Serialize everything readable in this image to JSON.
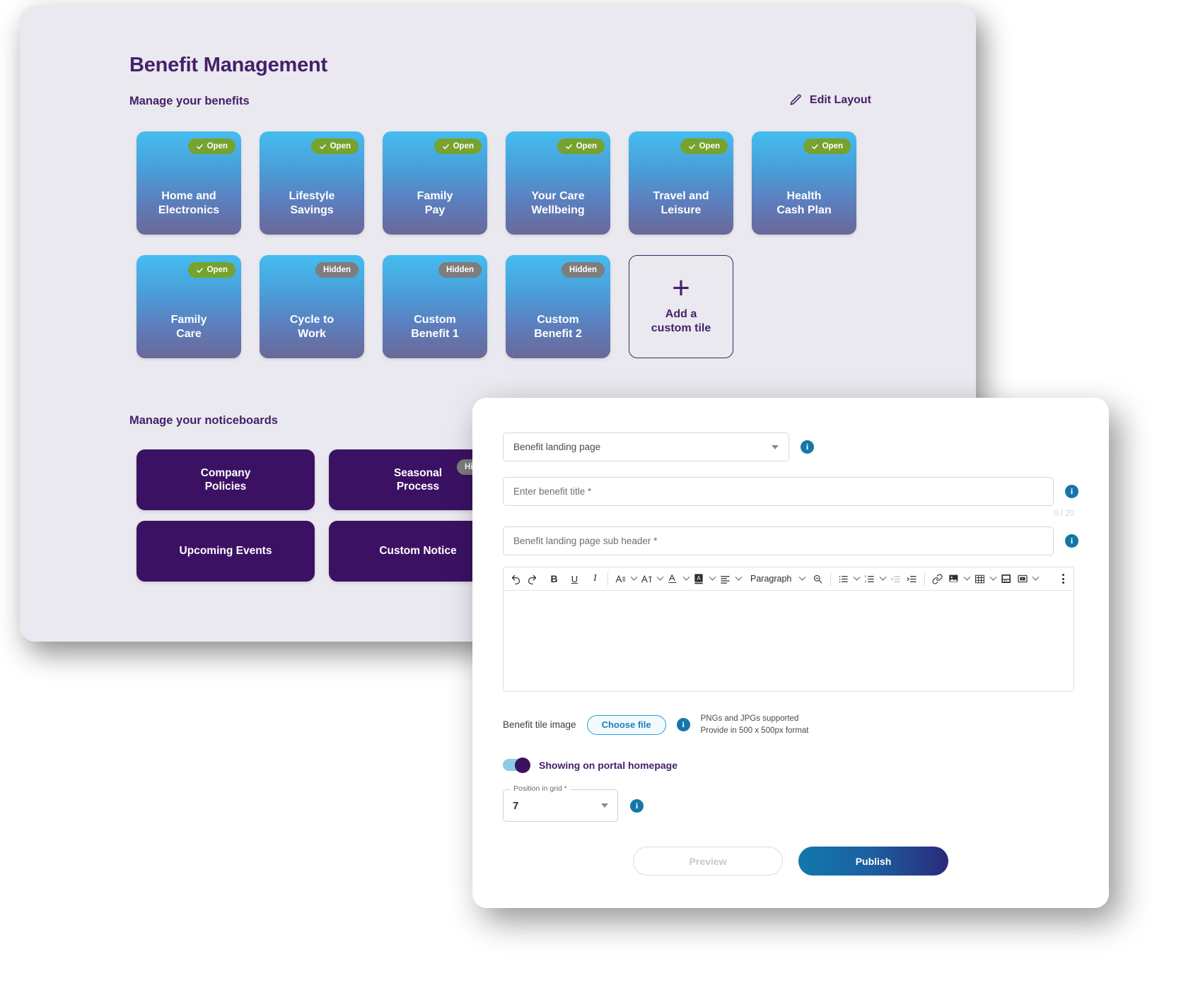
{
  "page": {
    "title": "Benefit Management",
    "benefits_label": "Manage your benefits",
    "noticeboards_label": "Manage your noticeboards",
    "edit_layout_label": "Edit Layout",
    "edit_layout_icon": "pencil-icon"
  },
  "colors": {
    "brand_purple": "#45206c",
    "tile_top": "#44bdf0",
    "tile_bottom": "#6a6898",
    "notice_bg": "#3b1263",
    "badge_open": "#76a22d",
    "badge_hidden": "#7d7d7d",
    "info_blue": "#1477a8",
    "publish_from": "#1179ab",
    "publish_to": "#2b2a7a"
  },
  "tiles": [
    {
      "title": "Home and\nElectronics",
      "status": "Open",
      "status_type": "open"
    },
    {
      "title": "Lifestyle\nSavings",
      "status": "Open",
      "status_type": "open"
    },
    {
      "title": "Family\nPay",
      "status": "Open",
      "status_type": "open"
    },
    {
      "title": "Your Care\nWellbeing",
      "status": "Open",
      "status_type": "open"
    },
    {
      "title": "Travel and\nLeisure",
      "status": "Open",
      "status_type": "open"
    },
    {
      "title": "Health\nCash Plan",
      "status": "Open",
      "status_type": "open"
    },
    {
      "title": "Family\nCare",
      "status": "Open",
      "status_type": "open"
    },
    {
      "title": "Cycle to\nWork",
      "status": "Hidden",
      "status_type": "hidden"
    },
    {
      "title": "Custom\nBenefit 1",
      "status": "Hidden",
      "status_type": "hidden"
    },
    {
      "title": "Custom\nBenefit 2",
      "status": "Hidden",
      "status_type": "hidden"
    }
  ],
  "add_tile": {
    "label": "Add a\ncustom tile",
    "icon": "plus-icon"
  },
  "noticeboards": [
    {
      "title": "Company\nPolicies",
      "status": null,
      "status_type": null
    },
    {
      "title": "Seasonal\nProcess",
      "status": "Hidden",
      "status_type": "hidden"
    },
    {
      "title": "Upcoming Events",
      "status": null,
      "status_type": null
    },
    {
      "title": "Custom Notice",
      "status": null,
      "status_type": null
    }
  ],
  "form": {
    "page_type": {
      "value": "Benefit landing page",
      "icon": "chevron-down-icon",
      "info_icon": "info-icon"
    },
    "title_field": {
      "placeholder": "Enter benefit title *",
      "value": "",
      "counter": "0 / 20",
      "info_icon": "info-icon"
    },
    "subheader_field": {
      "placeholder": "Benefit landing page sub header *",
      "value": "",
      "info_icon": "info-icon"
    },
    "editor": {
      "body": "",
      "toolbar": {
        "undo": "undo-icon",
        "redo": "redo-icon",
        "bold": "B",
        "underline": "U",
        "italic": "I",
        "font_family": "font-family-icon",
        "font_size": "font-size-icon",
        "font_color": "font-color-icon",
        "highlight": "highlight-color-icon",
        "align": "align-icon",
        "block_format": "Paragraph",
        "find_replace": "find-replace-icon",
        "bullet_list": "bullet-list-icon",
        "numbered_list": "numbered-list-icon",
        "outdent": "outdent-icon",
        "indent": "indent-icon",
        "link": "link-icon",
        "insert_image": "insert-image-icon",
        "insert_table": "insert-table-icon",
        "insert_media": "insert-media-icon",
        "insert_video": "insert-video-icon",
        "more": "more-options-icon"
      }
    },
    "upload": {
      "label": "Benefit tile image",
      "button": "Choose file",
      "info_icon": "info-icon",
      "hint_1": "PNGs and JPGs supported",
      "hint_2": "Provide in 500 x 500px format"
    },
    "toggle": {
      "label": "Showing on portal homepage",
      "state": "on"
    },
    "position": {
      "legend": "Position in grid *",
      "value": "7",
      "icon": "chevron-down-icon",
      "info_icon": "info-icon"
    },
    "actions": {
      "preview": "Preview",
      "publish": "Publish"
    }
  }
}
